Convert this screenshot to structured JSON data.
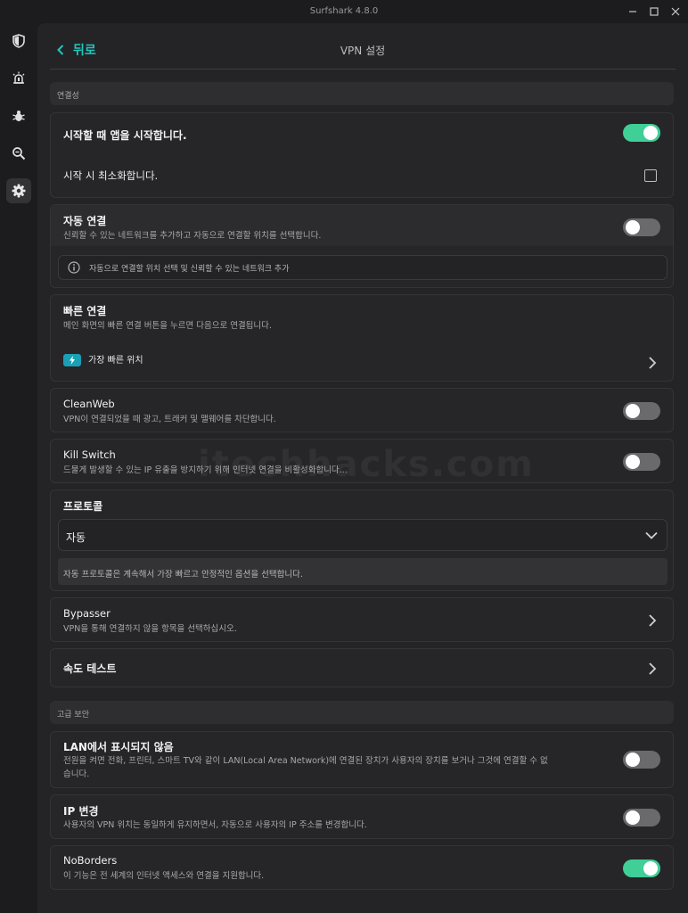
{
  "window": {
    "title": "Surfshark 4.8.0"
  },
  "header": {
    "back_label": "뒤로",
    "title": "VPN 설정"
  },
  "sidebar": {
    "items": [
      {
        "icon": "shield-icon"
      },
      {
        "icon": "alert-icon"
      },
      {
        "icon": "bug-icon"
      },
      {
        "icon": "search-zoom-icon"
      },
      {
        "icon": "gear-icon",
        "active": true
      }
    ]
  },
  "sections": {
    "connectivity": "연결성",
    "advanced": "고급 보안"
  },
  "startup": {
    "launch_title": "시작할 때 앱을 시작합니다.",
    "launch_on": true,
    "minimize_title": "시작 시 최소화합니다.",
    "minimize_checked": false
  },
  "auto_connect": {
    "title": "자동 연결",
    "desc": "신뢰할 수 있는 네트워크를 추가하고 자동으로 연결할 위치를 선택합니다.",
    "on": false,
    "info": "자동으로 연결할 위치 선택 및 신뢰할 수 있는 네트워크 추가"
  },
  "quick_connect": {
    "title": "빠른 연결",
    "desc": "메인 화면의 빠른 연결 버튼을 누르면 다음으로 연결됩니다.",
    "option": "가장 빠른 위치"
  },
  "cleanweb": {
    "title": "CleanWeb",
    "desc": "VPN이 연결되었을 때 광고, 트래커 및 맬웨어를 차단합니다.",
    "on": false
  },
  "kill_switch": {
    "title": "Kill Switch",
    "desc": "드물게 발생할 수 있는 IP 유출을 방지하기 위해 인터넷 연결을 비활성화합니다...",
    "on": false
  },
  "protocol": {
    "title": "프로토콜",
    "selected": "자동",
    "note": "자동 프로토콜은 계속해서 가장 빠르고 안정적인 옵션을 선택합니다."
  },
  "bypasser": {
    "title": "Bypasser",
    "desc": "VPN을 통해 연결하지 않을 항목을 선택하십시오."
  },
  "speed_test": {
    "title": "속도 테스트"
  },
  "lan": {
    "title": "LAN에서 표시되지 않음",
    "desc1": "전원을 켜면 전화, 프린터, 스마트 TV와 같이 LAN(Local Area Network)에 연결된 장치가 사용자의 장치를 보거나 그것에 연결할 수 없",
    "desc2": "습니다.",
    "on": false
  },
  "ip_rotator": {
    "title": "IP 변경",
    "desc": "사용자의 VPN 위치는 동일하게 유지하면서, 자동으로 사용자의 IP 주소를 변경합니다.",
    "on": false
  },
  "noborders": {
    "title": "NoBorders",
    "desc": "이 기능은 전 세계의 인터넷 액세스와 연결을 지원합니다.",
    "on": true
  },
  "watermark": "itechhacks.com",
  "colors": {
    "accent": "#1fc6bd",
    "toggle_on": "#3fcf97",
    "toggle_off": "#6a6a6d"
  }
}
